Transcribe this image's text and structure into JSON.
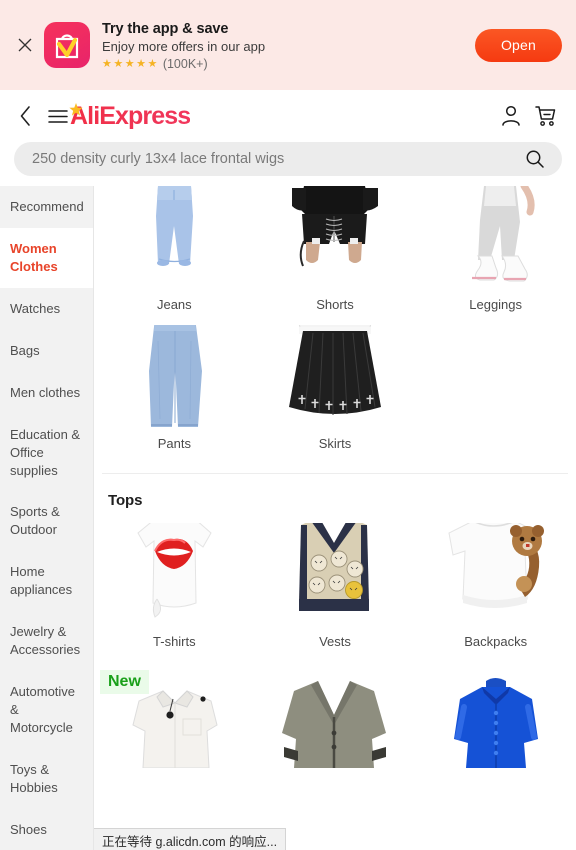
{
  "banner": {
    "close_icon": "close-icon",
    "app_icon": "shopping-bag-icon",
    "title": "Try the app & save",
    "subtitle": "Enjoy more offers in our app",
    "stars": "★★★★★",
    "rating_count": "(100K+)",
    "open_label": "Open",
    "bg_color": "#fce9e6",
    "button_color": "#f53a11"
  },
  "header": {
    "back_icon": "chevron-left-icon",
    "menu_icon": "hamburger-menu-icon",
    "logo_text": "AliExpress",
    "logo_color": "#f0324f",
    "account_icon": "user-account-icon",
    "cart_icon": "shopping-cart-icon"
  },
  "search": {
    "value": "250 density curly 13x4 lace frontal wigs",
    "placeholder": "250 density curly 13x4 lace frontal wigs",
    "search_icon": "search-icon"
  },
  "sidebar": {
    "items": [
      {
        "label": "Recommend",
        "active": false
      },
      {
        "label": "Women Clothes",
        "active": true
      },
      {
        "label": "Watches",
        "active": false
      },
      {
        "label": "Bags",
        "active": false
      },
      {
        "label": "Men clothes",
        "active": false
      },
      {
        "label": "Education & Office supplies",
        "active": false
      },
      {
        "label": "Sports & Outdoor",
        "active": false
      },
      {
        "label": "Home appliances",
        "active": false
      },
      {
        "label": "Jewelry & Accessories",
        "active": false
      },
      {
        "label": "Automotive & Motorcycle",
        "active": false
      },
      {
        "label": "Toys & Hobbies",
        "active": false
      },
      {
        "label": "Shoes",
        "active": false
      }
    ],
    "active_color": "#e8442a"
  },
  "content": {
    "bottoms_row1": [
      {
        "label": "Jeans",
        "image": "light-blue-jeans"
      },
      {
        "label": "Shorts",
        "image": "black-lace-up-shorts"
      },
      {
        "label": "Leggings",
        "image": "grey-leggings"
      }
    ],
    "bottoms_row2": [
      {
        "label": "Pants",
        "image": "wide-leg-denim-pants"
      },
      {
        "label": "Skirts",
        "image": "black-pleated-cross-skirt"
      }
    ],
    "tops_section_title": "Tops",
    "tops_row1": [
      {
        "label": "T-shirts",
        "image": "white-lips-tshirt"
      },
      {
        "label": "Vests",
        "image": "cat-pattern-knit-vest"
      },
      {
        "label": "Backpacks",
        "image": "bear-sweatshirt"
      }
    ],
    "tops_row2": [
      {
        "label": "",
        "image": "white-shirt",
        "badge": "New"
      },
      {
        "label": "",
        "image": "grey-cardigan"
      },
      {
        "label": "",
        "image": "blue-satin-blouse"
      }
    ],
    "new_badge_label": "New",
    "new_badge_color": "#1aa01a"
  },
  "status_bar": {
    "text": "正在等待 g.alicdn.com 的响应..."
  }
}
